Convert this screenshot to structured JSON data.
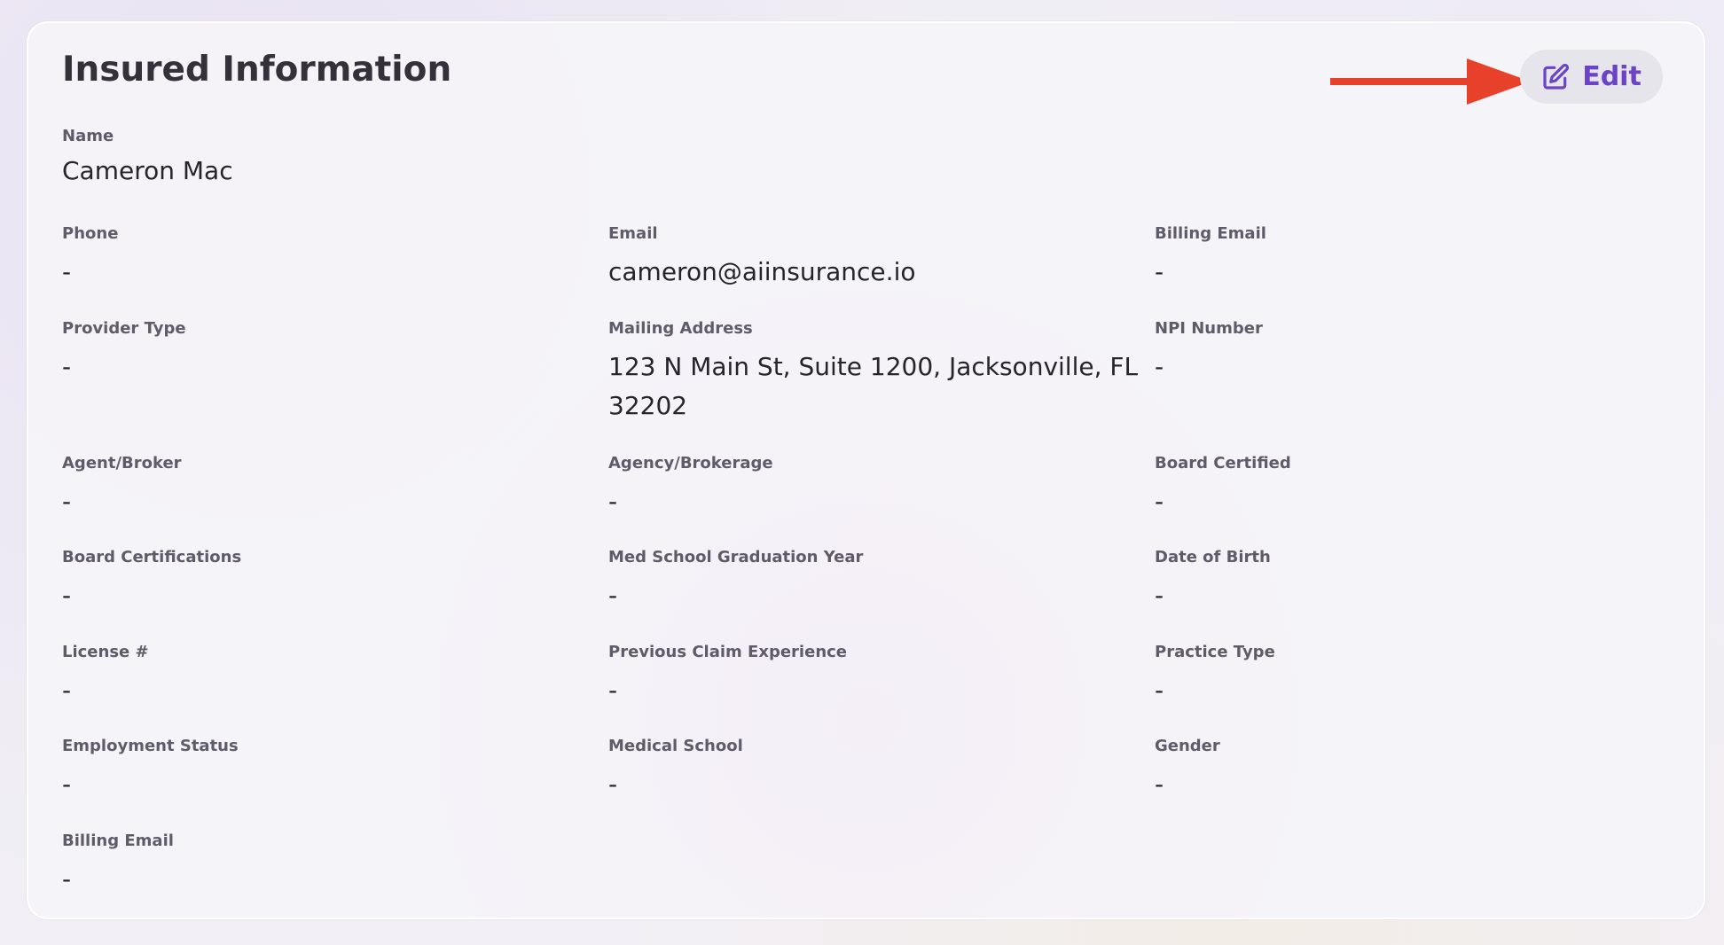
{
  "card": {
    "title": "Insured Information",
    "edit_label": "Edit"
  },
  "fields": {
    "name": {
      "label": "Name",
      "value": "Cameron Mac"
    },
    "phone": {
      "label": "Phone",
      "value": "-"
    },
    "email": {
      "label": "Email",
      "value": "cameron@aiinsurance.io"
    },
    "billing_email": {
      "label": "Billing Email",
      "value": "-"
    },
    "provider_type": {
      "label": "Provider Type",
      "value": "-"
    },
    "mailing_address": {
      "label": "Mailing Address",
      "value": "123 N Main St, Suite 1200, Jacksonville, FL 32202"
    },
    "npi_number": {
      "label": "NPI Number",
      "value": "-"
    },
    "agent_broker": {
      "label": "Agent/Broker",
      "value": "-"
    },
    "agency_brokerage": {
      "label": "Agency/Brokerage",
      "value": "-"
    },
    "board_certified": {
      "label": "Board Certified",
      "value": "-"
    },
    "board_certifications": {
      "label": "Board Certifications",
      "value": "-"
    },
    "med_school_graduation_year": {
      "label": "Med School Graduation Year",
      "value": "-"
    },
    "date_of_birth": {
      "label": "Date of Birth",
      "value": "-"
    },
    "license_number": {
      "label": "License #",
      "value": "-"
    },
    "previous_claim_experience": {
      "label": "Previous Claim Experience",
      "value": "-"
    },
    "practice_type": {
      "label": "Practice Type",
      "value": "-"
    },
    "employment_status": {
      "label": "Employment Status",
      "value": "-"
    },
    "medical_school": {
      "label": "Medical School",
      "value": "-"
    },
    "gender": {
      "label": "Gender",
      "value": "-"
    },
    "billing_email_2": {
      "label": "Billing Email",
      "value": "-"
    }
  },
  "colors": {
    "accent": "#6b44c6",
    "arrow": "#e8412b",
    "label_text": "#5f5b69",
    "value_text": "#26252b"
  },
  "icons": {
    "edit": "edit-icon",
    "annotation": "red-arrow-icon"
  }
}
